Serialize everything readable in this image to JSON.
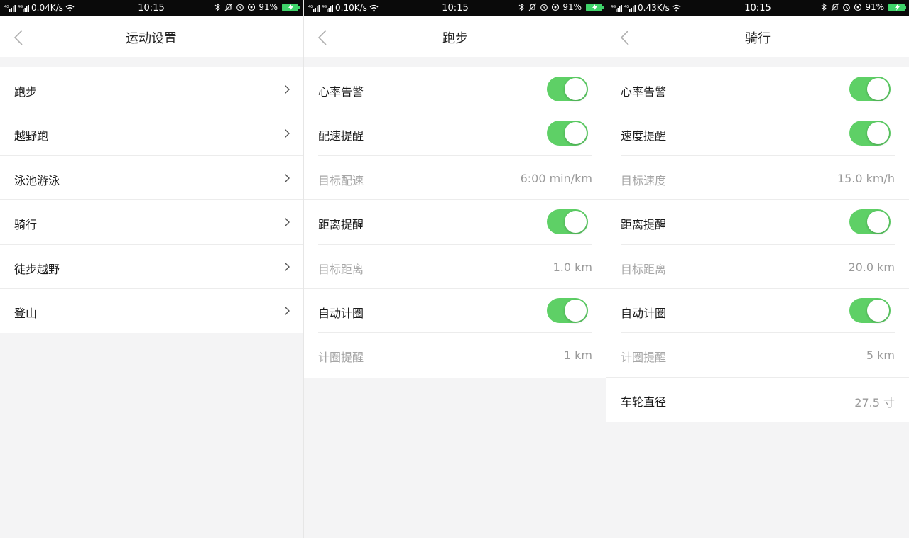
{
  "status_bar": {
    "carrier_left": "4G",
    "screens": [
      {
        "speed": "0.04K/s",
        "time": "10:15",
        "battery": "91%"
      },
      {
        "speed": "0.10K/s",
        "time": "10:15",
        "battery": "91%"
      },
      {
        "speed": "0.43K/s",
        "time": "10:15",
        "battery": "91%"
      }
    ]
  },
  "screen_settings": {
    "title": "运动设置",
    "items": [
      {
        "label": "跑步"
      },
      {
        "label": "越野跑"
      },
      {
        "label": "泳池游泳"
      },
      {
        "label": "骑行"
      },
      {
        "label": "徒步越野"
      },
      {
        "label": "登山"
      }
    ]
  },
  "screen_running": {
    "title": "跑步",
    "rows": [
      {
        "label": "心率告警",
        "toggle": true
      },
      {
        "label": "配速提醒",
        "toggle": true
      },
      {
        "label": "目标配速",
        "value": "6:00 min/km"
      },
      {
        "label": "距离提醒",
        "toggle": true
      },
      {
        "label": "目标距离",
        "value": "1.0 km"
      },
      {
        "label": "自动计圈",
        "toggle": true
      },
      {
        "label": "计圈提醒",
        "value": "1 km"
      }
    ]
  },
  "screen_cycling": {
    "title": "骑行",
    "rows": [
      {
        "label": "心率告警",
        "toggle": true
      },
      {
        "label": "速度提醒",
        "toggle": true
      },
      {
        "label": "目标速度",
        "value": "15.0 km/h"
      },
      {
        "label": "距离提醒",
        "toggle": true
      },
      {
        "label": "目标距离",
        "value": "20.0 km"
      },
      {
        "label": "自动计圈",
        "toggle": true
      },
      {
        "label": "计圈提醒",
        "value": "5 km"
      },
      {
        "label": "车轮直径",
        "value": "27.5 寸"
      }
    ]
  },
  "colors": {
    "toggle_on": "#5ed066",
    "background": "#f4f4f5",
    "secondary_text": "#a6a6a6"
  },
  "icons": [
    "back-arrow-icon",
    "chevron-right-icon",
    "bluetooth-icon",
    "mute-icon",
    "alarm-icon",
    "location-icon",
    "wifi-icon",
    "signal-icon",
    "battery-icon"
  ]
}
